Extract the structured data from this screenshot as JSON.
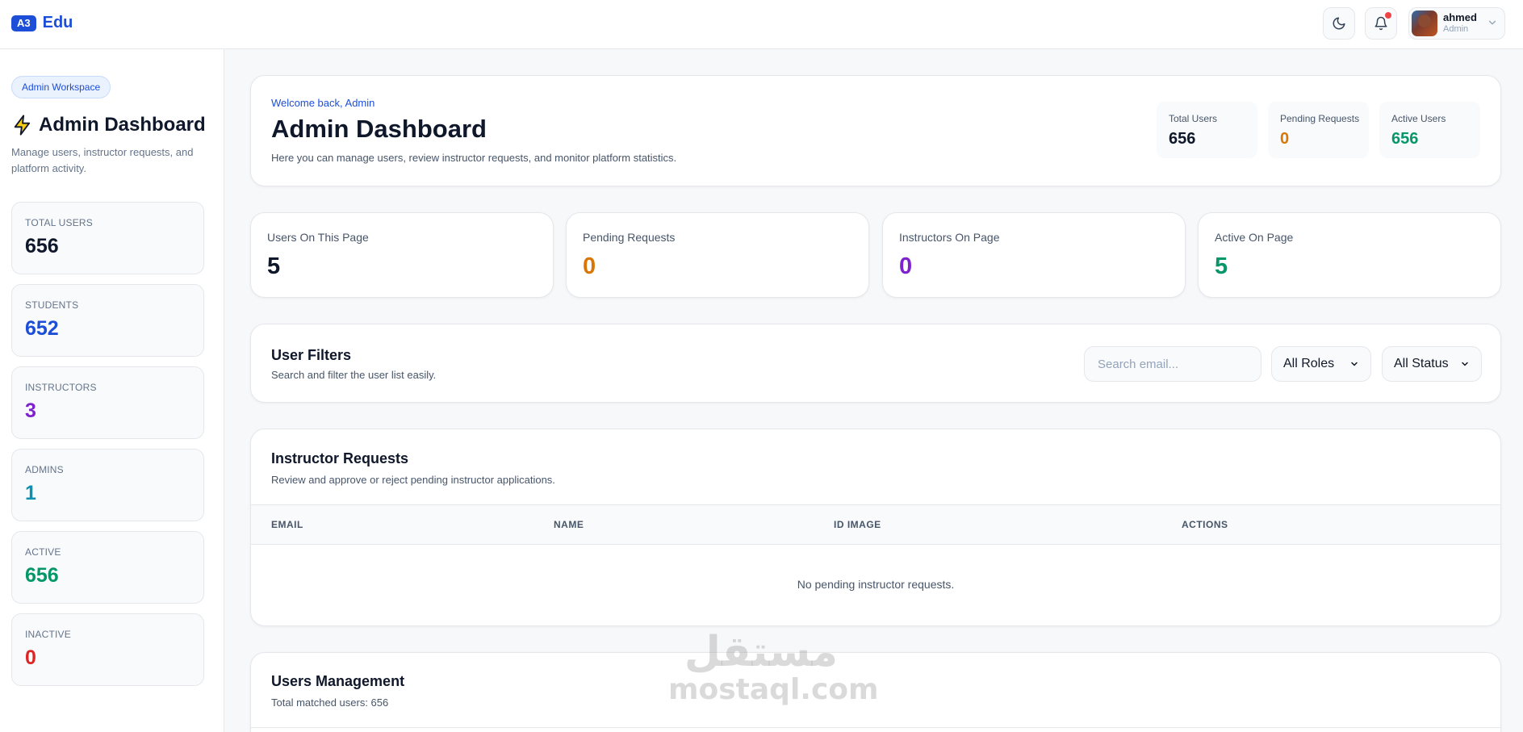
{
  "brand": {
    "badge": "A3",
    "name": "Edu"
  },
  "header": {
    "user": {
      "name": "ahmed",
      "role": "Admin"
    }
  },
  "sidebar": {
    "workspace_badge": "Admin Workspace",
    "title": "Admin Dashboard",
    "description": "Manage users, instructor requests, and platform activity.",
    "stats": [
      {
        "label": "TOTAL USERS",
        "value": "656",
        "color": "#0f172a"
      },
      {
        "label": "STUDENTS",
        "value": "652",
        "color": "#1d4ed8"
      },
      {
        "label": "INSTRUCTORS",
        "value": "3",
        "color": "#7e22ce"
      },
      {
        "label": "ADMINS",
        "value": "1",
        "color": "#0891b2"
      },
      {
        "label": "ACTIVE",
        "value": "656",
        "color": "#059669"
      },
      {
        "label": "INACTIVE",
        "value": "0",
        "color": "#dc2626"
      }
    ]
  },
  "hero": {
    "welcome": "Welcome back, Admin",
    "title": "Admin Dashboard",
    "description": "Here you can manage users, review instructor requests, and monitor platform statistics.",
    "mini_stats": [
      {
        "label": "Total Users",
        "value": "656",
        "color": "#0f172a"
      },
      {
        "label": "Pending Requests",
        "value": "0",
        "color": "#d97706"
      },
      {
        "label": "Active Users",
        "value": "656",
        "color": "#059669"
      }
    ]
  },
  "metrics": [
    {
      "label": "Users On This Page",
      "value": "5",
      "color": "#0f172a"
    },
    {
      "label": "Pending Requests",
      "value": "0",
      "color": "#d97706"
    },
    {
      "label": "Instructors On Page",
      "value": "0",
      "color": "#7e22ce"
    },
    {
      "label": "Active On Page",
      "value": "5",
      "color": "#059669"
    }
  ],
  "filters": {
    "title": "User Filters",
    "subtitle": "Search and filter the user list easily.",
    "search_placeholder": "Search email...",
    "role_selected": "All Roles",
    "status_selected": "All Status"
  },
  "requests": {
    "title": "Instructor Requests",
    "subtitle": "Review and approve or reject pending instructor applications.",
    "columns": [
      "EMAIL",
      "NAME",
      "ID IMAGE",
      "ACTIONS"
    ],
    "empty_text": "No pending instructor requests."
  },
  "management": {
    "title": "Users Management",
    "subtitle": "Total matched users: 656"
  },
  "watermark": {
    "arabic": "مستقل",
    "latin": "mostaql.com"
  },
  "colors": {
    "accent": "#1d4ed8",
    "notification_dot": "#ef4444"
  }
}
